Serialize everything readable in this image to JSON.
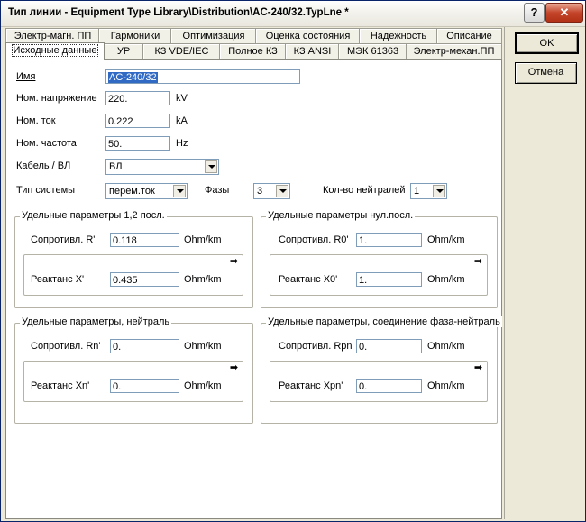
{
  "window": {
    "title": "Тип линии - Equipment Type Library\\Distribution\\AC-240/32.TypLne *",
    "help_label": "?",
    "close_label": "✕"
  },
  "side_buttons": {
    "ok": "OK",
    "cancel": "Отмена"
  },
  "tabs_row1": [
    "Электр-магн. ПП",
    "Гармоники",
    "Оптимизация",
    "Оценка состояния",
    "Надежность",
    "Описание"
  ],
  "tabs_row2": [
    "Исходные данные",
    "УР",
    "КЗ VDE/IEC",
    "Полное КЗ",
    "КЗ ANSI",
    "МЭК 61363",
    "Электр-механ.ПП"
  ],
  "form": {
    "name": {
      "label": "Имя",
      "value": "AC-240/32"
    },
    "voltage": {
      "label": "Ном. напряжение",
      "value": "220.",
      "unit": "kV"
    },
    "current": {
      "label": "Ном. ток",
      "value": "0.222",
      "unit": "kA"
    },
    "frequency": {
      "label": "Ном. частота",
      "value": "50.",
      "unit": "Hz"
    },
    "cable": {
      "label": "Кабель / ВЛ",
      "value": "ВЛ"
    },
    "system": {
      "label": "Тип системы",
      "value": "перем.ток"
    },
    "phases": {
      "label": "Фазы",
      "value": "3"
    },
    "neutrals": {
      "label": "Кол-во нейтралей",
      "value": "1"
    }
  },
  "groups": {
    "pos": {
      "title": "Удельные параметры 1,2 посл.",
      "r_label": "Сопротивл. R'",
      "r_value": "0.118",
      "r_unit": "Ohm/km",
      "x_label": "Реактанс X'",
      "x_value": "0.435",
      "x_unit": "Ohm/km"
    },
    "zero": {
      "title": "Удельные параметры нул.посл.",
      "r_label": "Сопротивл. R0'",
      "r_value": "1.",
      "r_unit": "Ohm/km",
      "x_label": "Реактанс X0'",
      "x_value": "1.",
      "x_unit": "Ohm/km"
    },
    "neutral": {
      "title": "Удельные параметры, нейтраль",
      "r_label": "Сопротивл. Rn'",
      "r_value": "0.",
      "r_unit": "Ohm/km",
      "x_label": "Реактанс Xn'",
      "x_value": "0.",
      "x_unit": "Ohm/km"
    },
    "phase_neutral": {
      "title": "Удельные параметры, соединение фаза-нейтраль",
      "r_label": "Сопротивл. Rpn'",
      "r_value": "0.",
      "r_unit": "Ohm/km",
      "x_label": "Реактанс Xpn'",
      "x_value": "0.",
      "x_unit": "Ohm/km"
    }
  },
  "arrow_glyph": "➡",
  "colors": {
    "selection": "#316ac5",
    "close_button": "#c4452a",
    "dialog_bg": "#ece9d8"
  }
}
